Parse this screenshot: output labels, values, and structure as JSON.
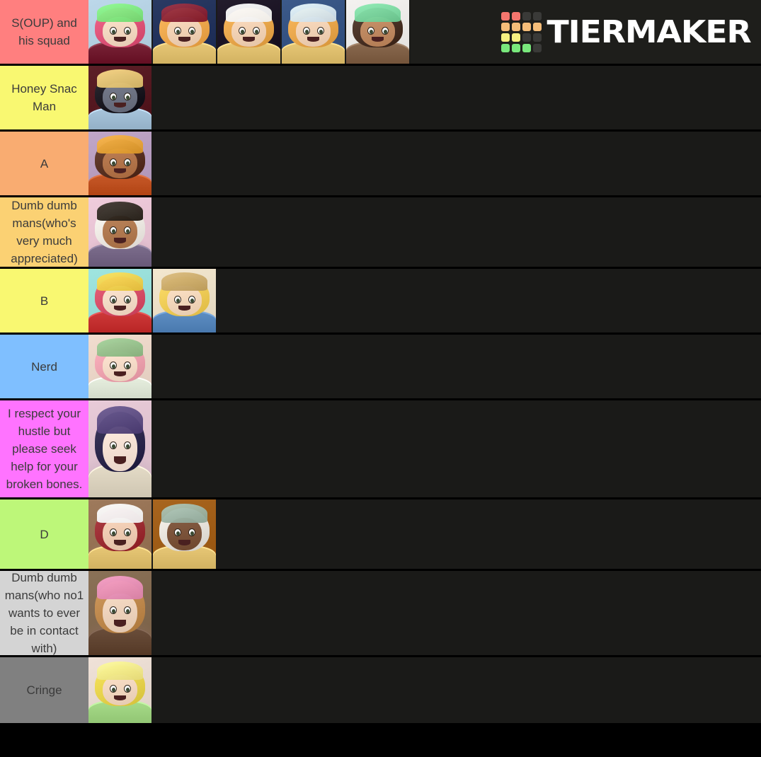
{
  "app": {
    "name": "TierMaker",
    "logo_text": "TIERMAKER",
    "background_color": "#000000",
    "drop_area_color": "#1a1a18"
  },
  "logo": {
    "grid_colors": [
      "#f4766e",
      "#f4766e",
      "#3a3a38",
      "#3a3a38",
      "#f5bd79",
      "#f5bd79",
      "#f5bd79",
      "#f5bd79",
      "#f6f080",
      "#f6f080",
      "#3a3a38",
      "#3a3a38",
      "#79e87c",
      "#79e87c",
      "#79e87c",
      "#3a3a38"
    ]
  },
  "tiers": [
    {
      "label": "S(OUP) and his squad",
      "color": "#ff7f7f",
      "items": [
        {
          "name": "pink-haired-character-with-heart-jar",
          "palette": {
            "bg": "#bcd8ea",
            "hair": "#e0557a",
            "skin": "#f4d9c2",
            "outfit": "#7a2438",
            "accent": "#7ee87e"
          }
        },
        {
          "name": "blond-character-gold-helmet-shouting",
          "palette": {
            "bg": "#2a3a63",
            "hair": "#f0a94e",
            "skin": "#f3d3b6",
            "outfit": "#e8c877",
            "accent": "#8c2436"
          }
        },
        {
          "name": "blond-character-gold-helmet-dark-bg",
          "palette": {
            "bg": "#231c2c",
            "hair": "#eaa84d",
            "skin": "#f3d3b6",
            "outfit": "#e8c877",
            "accent": "#ffffff"
          }
        },
        {
          "name": "blond-character-gold-helmet-waving",
          "palette": {
            "bg": "#3c5a8a",
            "hair": "#eaa84d",
            "skin": "#f3d3b6",
            "outfit": "#e8c877",
            "accent": "#d8e8f5"
          }
        },
        {
          "name": "curly-haired-character-with-stars",
          "palette": {
            "bg": "#f4f2f0",
            "hair": "#4a3327",
            "skin": "#c08a62",
            "outfit": "#8a6a50",
            "accent": "#7ad8a0"
          }
        }
      ]
    },
    {
      "label": "Honey Snac Man",
      "color": "#f9f871",
      "items": [
        {
          "name": "construction-helmet-character-dark-skin",
          "palette": {
            "bg": "#5c2028",
            "hair": "#1c1a22",
            "skin": "#6e7383",
            "outfit": "#a9c6dd",
            "accent": "#e8c877"
          }
        }
      ]
    },
    {
      "label": "A",
      "color": "#f9ac71",
      "items": [
        {
          "name": "cowboy-hat-character",
          "palette": {
            "bg": "#c0a6c8",
            "hair": "#5a3324",
            "skin": "#b4764c",
            "outfit": "#c85a2a",
            "accent": "#e8a437"
          }
        }
      ]
    },
    {
      "label": "Dumb dumb mans(who's very much appreciated)",
      "color": "#fbd173",
      "items": [
        {
          "name": "white-haired-bearded-character",
          "palette": {
            "bg": "#f0ccdc",
            "hair": "#efeae4",
            "skin": "#b27b52",
            "outfit": "#7e6f8e",
            "accent": "#2e2720"
          }
        }
      ]
    },
    {
      "label": "B",
      "color": "#f9f871",
      "items": [
        {
          "name": "red-haired-character-in-red-outfit",
          "palette": {
            "bg": "#9fe5e0",
            "hair": "#d8506a",
            "skin": "#f5ddc8",
            "outfit": "#cf3b3b",
            "accent": "#f2d04a"
          }
        },
        {
          "name": "blond-character-blue-overalls",
          "palette": {
            "bg": "#f3e7cf",
            "hair": "#f2cd58",
            "skin": "#f5d9bd",
            "outfit": "#5f8fc4",
            "accent": "#c9a96a"
          }
        }
      ]
    },
    {
      "label": "Nerd",
      "color": "#7fbfff",
      "items": [
        {
          "name": "pink-haired-character-with-round-glasses",
          "palette": {
            "bg": "#f2ddcf",
            "hair": "#f0a3b0",
            "skin": "#f7ddca",
            "outfit": "#e8f0e0",
            "accent": "#93c08a"
          }
        }
      ]
    },
    {
      "label": "I respect your hustle but please seek help for your broken bones.",
      "color": "#ff73ff",
      "items": [
        {
          "name": "dark-haired-character-smiling",
          "palette": {
            "bg": "#e8cbd8",
            "hair": "#2e2a4e",
            "skin": "#f7e3d6",
            "outfit": "#e5dcc8",
            "accent": "#5a4a80"
          }
        }
      ]
    },
    {
      "label": "D",
      "color": "#bdf779",
      "items": [
        {
          "name": "red-haired-angry-character",
          "palette": {
            "bg": "#9e7a5c",
            "hair": "#9e2f35",
            "skin": "#f0cdb4",
            "outfit": "#e8c877",
            "accent": "#ffffff"
          }
        },
        {
          "name": "white-haired-character-with-glasses",
          "palette": {
            "bg": "#a8651f",
            "hair": "#e8e4dd",
            "skin": "#7d553c",
            "outfit": "#e8c877",
            "accent": "#9db5a6"
          }
        }
      ]
    },
    {
      "label": "Dumb dumb mans(who no1 wants to ever be in contact with)",
      "color": "#d4d4d4",
      "items": [
        {
          "name": "bearded-man-with-cap-and-brooch",
          "palette": {
            "bg": "#8a7157",
            "hair": "#c08a4e",
            "skin": "#efd4bd",
            "outfit": "#6b4f3c",
            "accent": "#e890b8"
          }
        }
      ]
    },
    {
      "label": "Cringe",
      "color": "#808080",
      "items": [
        {
          "name": "blond-character-with-flower-collar-waving",
          "palette": {
            "bg": "#f0e2d8",
            "hair": "#e8d44e",
            "skin": "#f3d8c0",
            "outfit": "#a8dc8a",
            "accent": "#f5e98a"
          }
        }
      ]
    }
  ]
}
